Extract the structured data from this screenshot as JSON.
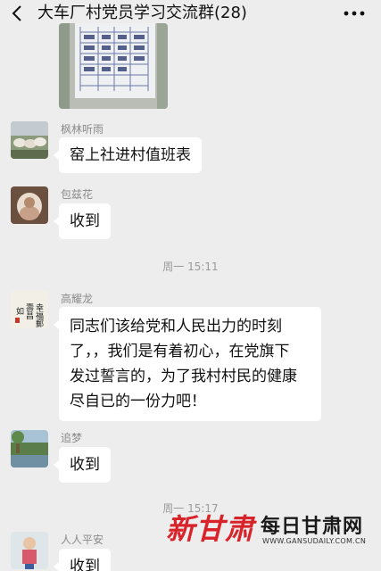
{
  "header": {
    "title": "大车厂村党员学习交流群(28)",
    "back_icon": "chevron-left-icon",
    "more_icon": "more-dots-icon"
  },
  "messages": [
    {
      "sender": "枫林听雨",
      "text": "窑上社进村值班表"
    },
    {
      "sender": "包兹花",
      "text": "收到"
    },
    {
      "timestamp": "周一 15:11"
    },
    {
      "sender": "高耀龙",
      "lines": [
        "同志们该给党和人民出力的时刻",
        "了，，我们是有着初心，在党旗下",
        "发过誓言的，为了我村村民的健康",
        "尽自已的一份力吧！"
      ]
    },
    {
      "sender": "追梦",
      "text": "收到"
    },
    {
      "timestamp": "周一 15:17"
    },
    {
      "sender": "人人平安",
      "text": "收到"
    }
  ],
  "avatar_calligraphy": [
    "幸福郵",
    "壽昌",
    "如"
  ],
  "watermark": {
    "brand": "新甘肃",
    "name": "每日甘肃网",
    "url": "WWW.GANSUDAILY.COM.CN",
    "brand_color": "#d8232a"
  }
}
